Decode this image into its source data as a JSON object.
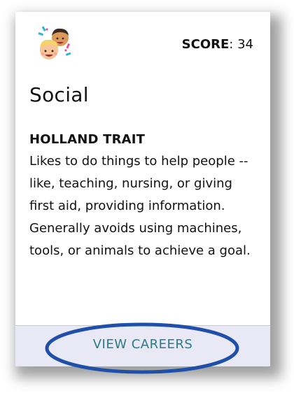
{
  "card": {
    "score_label": "SCORE",
    "score_separator": ":",
    "score_value": "34",
    "title": "Social",
    "trait_heading": "HOLLAND TRAIT",
    "description": "Likes to do things to help people -- like, teaching, nursing, or giving first aid, providing information. Generally avoids using machines, tools, or animals to achieve a goal.",
    "avatar_icon": "people-emoji-icon",
    "view_careers_label": "VIEW CAREERS"
  },
  "colors": {
    "link": "#2a7a87",
    "footer_bg": "#e9e9f6",
    "highlight_ring": "#1f4fa8"
  }
}
